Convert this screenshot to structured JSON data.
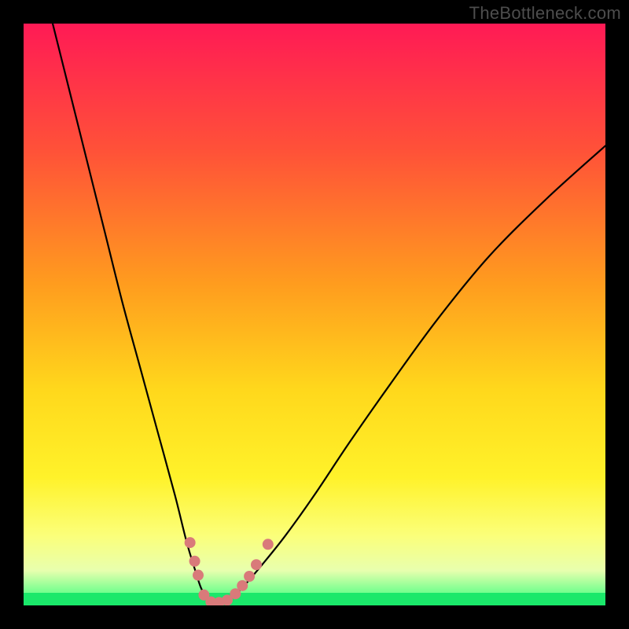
{
  "watermark": "TheBottleneck.com",
  "chart_data": {
    "type": "line",
    "title": "",
    "xlabel": "",
    "ylabel": "",
    "xlim": [
      0,
      100
    ],
    "ylim": [
      0,
      100
    ],
    "gradient": {
      "stops": [
        {
          "pos": 0,
          "color": "#ff1a55"
        },
        {
          "pos": 22,
          "color": "#ff5238"
        },
        {
          "pos": 45,
          "color": "#ff9d1e"
        },
        {
          "pos": 63,
          "color": "#ffd81c"
        },
        {
          "pos": 78,
          "color": "#fff22a"
        },
        {
          "pos": 88,
          "color": "#fbff7a"
        },
        {
          "pos": 94,
          "color": "#e8ffae"
        },
        {
          "pos": 100,
          "color": "#2dff7b"
        }
      ]
    },
    "green_strip": {
      "height_pct": 2.2,
      "color": "#1ae86a"
    },
    "series": [
      {
        "name": "bottleneck-curve",
        "x": [
          5,
          8,
          11,
          14,
          17,
          20,
          23,
          26,
          28,
          29.5,
          30.5,
          31.5,
          33,
          34.5,
          36,
          38,
          41,
          45,
          50,
          56,
          63,
          71,
          80,
          90,
          100
        ],
        "y": [
          100,
          88,
          76,
          64,
          52,
          41,
          30,
          19,
          11,
          6,
          3,
          1.3,
          0.4,
          0.6,
          1.5,
          3.5,
          7,
          12,
          19,
          28,
          38,
          49,
          60,
          70,
          79
        ]
      }
    ],
    "points": {
      "name": "trough-dots",
      "color": "#d97a7a",
      "radius": 7,
      "coords": [
        {
          "x": 28.6,
          "y": 10.8
        },
        {
          "x": 29.4,
          "y": 7.6
        },
        {
          "x": 30.0,
          "y": 5.2
        },
        {
          "x": 31.0,
          "y": 1.8
        },
        {
          "x": 32.2,
          "y": 0.6
        },
        {
          "x": 33.6,
          "y": 0.5
        },
        {
          "x": 35.0,
          "y": 0.9
        },
        {
          "x": 36.4,
          "y": 2.0
        },
        {
          "x": 37.6,
          "y": 3.4
        },
        {
          "x": 38.8,
          "y": 5.0
        },
        {
          "x": 40.0,
          "y": 7.0
        },
        {
          "x": 42.0,
          "y": 10.5
        }
      ]
    }
  }
}
